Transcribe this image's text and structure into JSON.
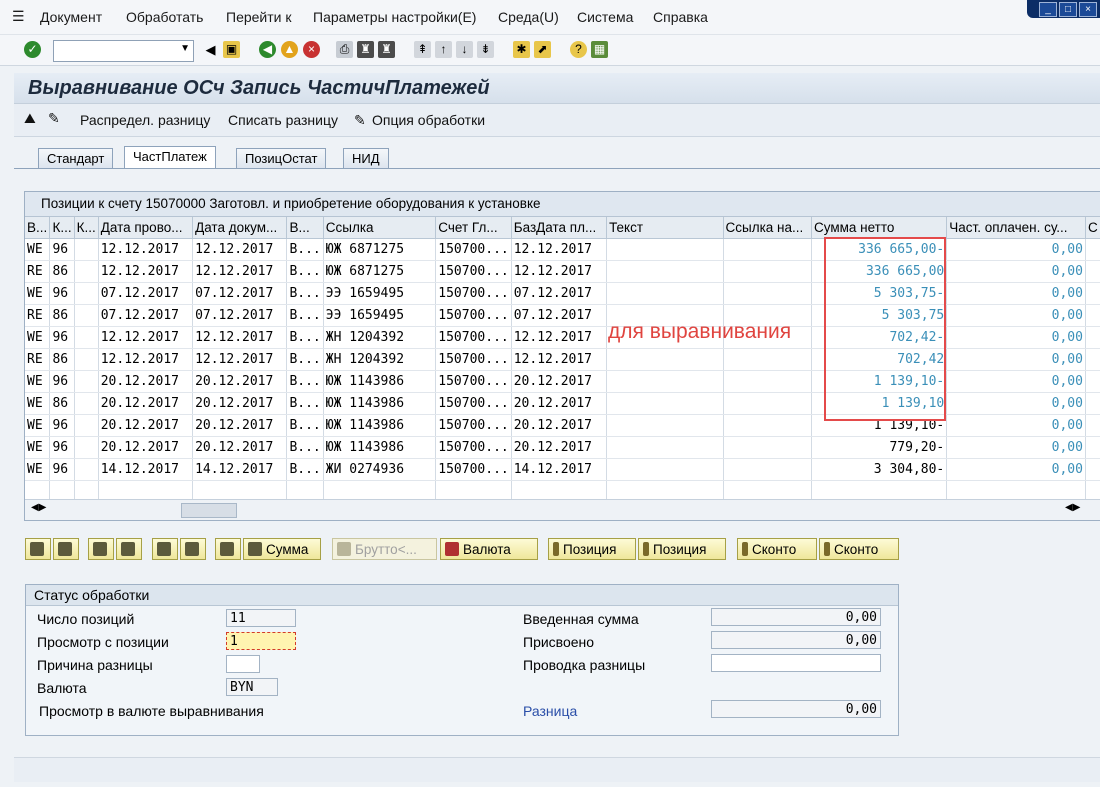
{
  "menu": [
    "Документ",
    "Обработать",
    "Перейти к",
    "Параметры настройки(E)",
    "Среда(U)",
    "Система",
    "Справка"
  ],
  "toolbar": {
    "command_value": ""
  },
  "title": "Выравнивание ОСч Запись ЧастичПлатежей",
  "app_toolbar": {
    "distribute": "Распредел. разницу",
    "write_off": "Списать разницу",
    "options": "Опция обработки"
  },
  "tabs": [
    "Стандарт",
    "ЧастПлатеж",
    "ПозицОстат",
    "НИД"
  ],
  "grid": {
    "title": "Позиции к счету 15070000 Заготовл. и приобретение оборудования к установке",
    "headers": [
      "В...",
      "К...",
      "К...",
      "Дата прово...",
      "Дата докум...",
      "В...",
      "Ссылка",
      "Счет Гл...",
      "БазДата пл...",
      "Текст",
      "Ссылка на...",
      "Сумма нетто",
      "Част. оплачен. су...",
      "С"
    ],
    "rows": [
      [
        "WE",
        "96",
        "",
        "12.12.2017",
        "12.12.2017",
        "В...",
        "ЮЖ 6871275",
        "150700...",
        "12.12.2017",
        "",
        "",
        "336 665,00-",
        "0,00"
      ],
      [
        "RE",
        "86",
        "",
        "12.12.2017",
        "12.12.2017",
        "В...",
        "ЮЖ 6871275",
        "150700...",
        "12.12.2017",
        "",
        "",
        "336 665,00",
        "0,00"
      ],
      [
        "WE",
        "96",
        "",
        "07.12.2017",
        "07.12.2017",
        "В...",
        "ЭЭ 1659495",
        "150700...",
        "07.12.2017",
        "",
        "",
        "5 303,75-",
        "0,00"
      ],
      [
        "RE",
        "86",
        "",
        "07.12.2017",
        "07.12.2017",
        "В...",
        "ЭЭ 1659495",
        "150700...",
        "07.12.2017",
        "",
        "",
        "5 303,75",
        "0,00"
      ],
      [
        "WE",
        "96",
        "",
        "12.12.2017",
        "12.12.2017",
        "В...",
        "ЖН 1204392",
        "150700...",
        "12.12.2017",
        "",
        "",
        "702,42-",
        "0,00"
      ],
      [
        "RE",
        "86",
        "",
        "12.12.2017",
        "12.12.2017",
        "В...",
        "ЖН 1204392",
        "150700...",
        "12.12.2017",
        "",
        "",
        "702,42",
        "0,00"
      ],
      [
        "WE",
        "96",
        "",
        "20.12.2017",
        "20.12.2017",
        "В...",
        "ЮЖ 1143986",
        "150700...",
        "20.12.2017",
        "",
        "",
        "1 139,10-",
        "0,00"
      ],
      [
        "WE",
        "86",
        "",
        "20.12.2017",
        "20.12.2017",
        "В...",
        "ЮЖ 1143986",
        "150700...",
        "20.12.2017",
        "",
        "",
        "1 139,10",
        "0,00"
      ],
      [
        "WE",
        "96",
        "",
        "20.12.2017",
        "20.12.2017",
        "В...",
        "ЮЖ 1143986",
        "150700...",
        "20.12.2017",
        "",
        "",
        "1 139,10-",
        "0,00"
      ],
      [
        "WE",
        "96",
        "",
        "20.12.2017",
        "20.12.2017",
        "В...",
        "ЮЖ 1143986",
        "150700...",
        "20.12.2017",
        "",
        "",
        "779,20-",
        "0,00"
      ],
      [
        "WE",
        "96",
        "",
        "14.12.2017",
        "14.12.2017",
        "В...",
        "ЖИ 0274936",
        "150700...",
        "14.12.2017",
        "",
        "",
        "3 304,80-",
        "0,00"
      ]
    ],
    "highlighted_rows": 8
  },
  "annotation": "для выравнивания",
  "buttons": {
    "sum": "Сумма",
    "gross": "Брутто<...",
    "currency": "Валюта",
    "pos1": "Позиция",
    "pos2": "Позиция",
    "disc1": "Сконто",
    "disc2": "Сконто"
  },
  "status": {
    "title": "Статус обработки",
    "num_items_label": "Число позиций",
    "num_items": "11",
    "view_from_label": "Просмотр с позиции",
    "view_from": "1",
    "reason_label": "Причина разницы",
    "reason": "",
    "currency_label": "Валюта",
    "currency": "BYN",
    "view_in_currency_label": "Просмотр в валюте выравнивания",
    "entered_label": "Введенная сумма",
    "entered": "0,00",
    "assigned_label": "Присвоено",
    "assigned": "0,00",
    "posting_label": "Проводка разницы",
    "posting": "",
    "difference_label": "Разница",
    "difference": "0,00"
  },
  "colors": {
    "accent_blue": "#3a8fb8",
    "annotation_red": "#e44a4a",
    "button_yellow": "#efe79a"
  }
}
